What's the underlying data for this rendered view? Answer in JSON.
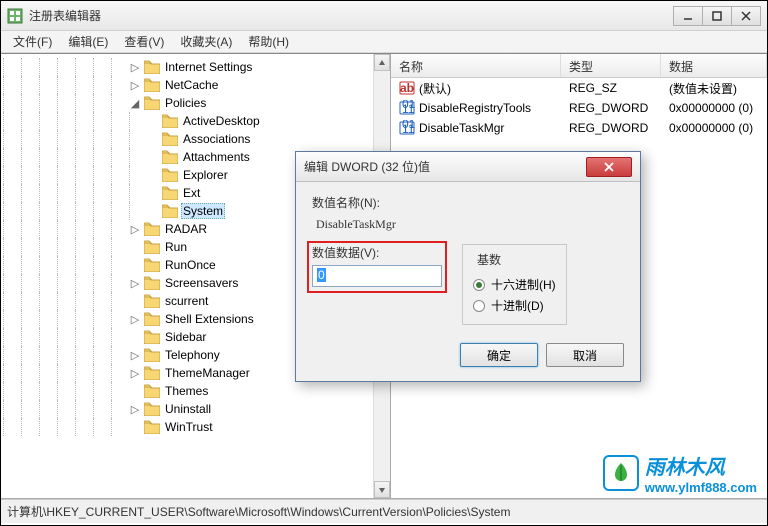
{
  "window": {
    "title": "注册表编辑器"
  },
  "menu": {
    "file": "文件(F)",
    "edit": "编辑(E)",
    "view": "查看(V)",
    "favorites": "收藏夹(A)",
    "help": "帮助(H)"
  },
  "tree": {
    "items": [
      {
        "indent": 7,
        "toggle": "▷",
        "label": "Internet Settings"
      },
      {
        "indent": 7,
        "toggle": "▷",
        "label": "NetCache"
      },
      {
        "indent": 7,
        "toggle": "◢",
        "label": "Policies"
      },
      {
        "indent": 8,
        "toggle": "",
        "label": "ActiveDesktop"
      },
      {
        "indent": 8,
        "toggle": "",
        "label": "Associations"
      },
      {
        "indent": 8,
        "toggle": "",
        "label": "Attachments"
      },
      {
        "indent": 8,
        "toggle": "",
        "label": "Explorer"
      },
      {
        "indent": 8,
        "toggle": "",
        "label": "Ext"
      },
      {
        "indent": 8,
        "toggle": "",
        "label": "System",
        "selected": true
      },
      {
        "indent": 7,
        "toggle": "▷",
        "label": "RADAR"
      },
      {
        "indent": 7,
        "toggle": "",
        "label": "Run"
      },
      {
        "indent": 7,
        "toggle": "",
        "label": "RunOnce"
      },
      {
        "indent": 7,
        "toggle": "▷",
        "label": "Screensavers"
      },
      {
        "indent": 7,
        "toggle": "",
        "label": "scurrent"
      },
      {
        "indent": 7,
        "toggle": "▷",
        "label": "Shell Extensions"
      },
      {
        "indent": 7,
        "toggle": "",
        "label": "Sidebar"
      },
      {
        "indent": 7,
        "toggle": "▷",
        "label": "Telephony"
      },
      {
        "indent": 7,
        "toggle": "▷",
        "label": "ThemeManager"
      },
      {
        "indent": 7,
        "toggle": "",
        "label": "Themes"
      },
      {
        "indent": 7,
        "toggle": "▷",
        "label": "Uninstall"
      },
      {
        "indent": 7,
        "toggle": "",
        "label": "WinTrust"
      }
    ]
  },
  "list": {
    "headers": {
      "name": "名称",
      "type": "类型",
      "data": "数据"
    },
    "rows": [
      {
        "icon": "string",
        "name": "(默认)",
        "type": "REG_SZ",
        "data": "(数值未设置)"
      },
      {
        "icon": "dword",
        "name": "DisableRegistryTools",
        "type": "REG_DWORD",
        "data": "0x00000000 (0)"
      },
      {
        "icon": "dword",
        "name": "DisableTaskMgr",
        "type": "REG_DWORD",
        "data": "0x00000000 (0)"
      }
    ]
  },
  "dialog": {
    "title": "编辑 DWORD (32 位)值",
    "name_label": "数值名称(N):",
    "name_value": "DisableTaskMgr",
    "data_label": "数值数据(V):",
    "data_value": "0",
    "base_label": "基数",
    "radix_hex": "十六进制(H)",
    "radix_dec": "十进制(D)",
    "ok": "确定",
    "cancel": "取消"
  },
  "statusbar": {
    "path": "计算机\\HKEY_CURRENT_USER\\Software\\Microsoft\\Windows\\CurrentVersion\\Policies\\System"
  },
  "watermark": {
    "cn": "雨林木风",
    "url": "www.ylmf888.com"
  }
}
